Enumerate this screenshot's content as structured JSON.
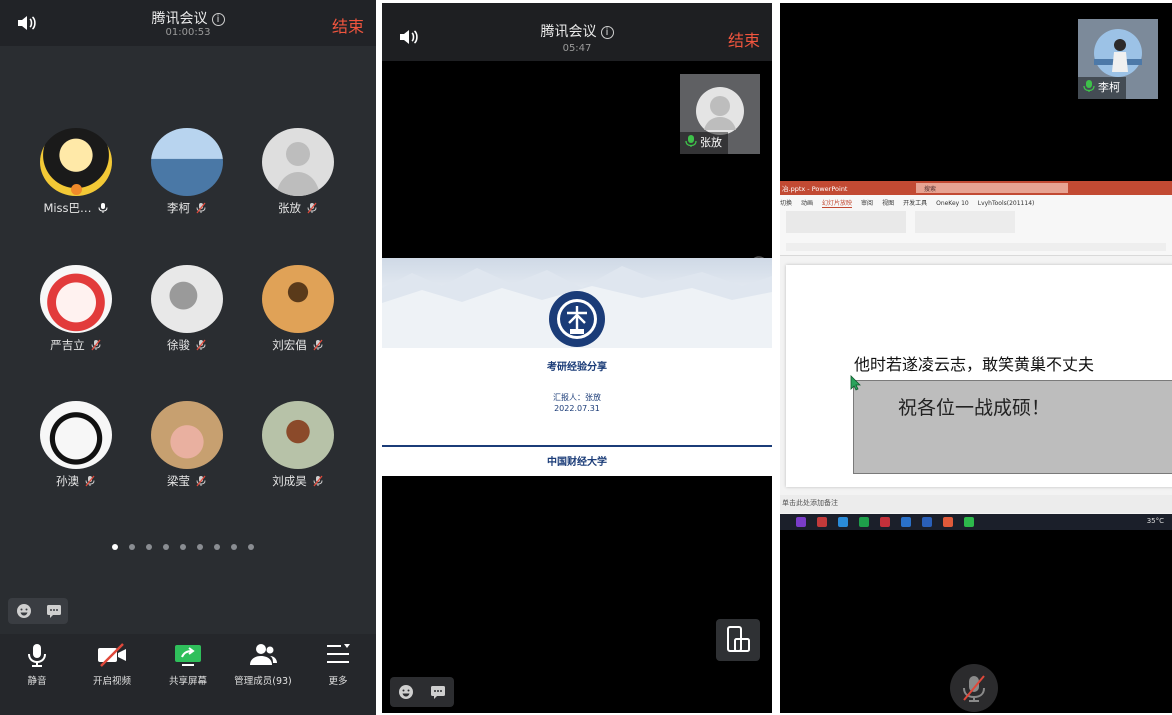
{
  "left_panel": {
    "title": "腾讯会议",
    "duration": "01:00:53",
    "end_label": "结束",
    "members": [
      {
        "name": "Miss巴…",
        "muted": false
      },
      {
        "name": "李柯",
        "muted": true
      },
      {
        "name": "张放",
        "muted": true
      },
      {
        "name": "严吉立",
        "muted": true
      },
      {
        "name": "徐骏",
        "muted": true
      },
      {
        "name": "刘宏倡",
        "muted": true
      },
      {
        "name": "孙澳",
        "muted": true
      },
      {
        "name": "梁莹",
        "muted": true
      },
      {
        "name": "刘成昊",
        "muted": true
      }
    ],
    "page_count": 9,
    "active_page": 1,
    "toolbar": [
      {
        "label": "静音",
        "icon": "mic-icon"
      },
      {
        "label": "开启视频",
        "icon": "video-off-icon"
      },
      {
        "label": "共享屏幕",
        "icon": "share-screen-icon"
      },
      {
        "label": "管理成员(93)",
        "icon": "members-icon"
      },
      {
        "label": "更多",
        "icon": "more-icon"
      }
    ]
  },
  "middle_panel": {
    "title": "腾讯会议",
    "duration": "05:47",
    "end_label": "结束",
    "speaker_name": "张放",
    "slide": {
      "title": "考研经验分享",
      "reporter": "汇报人：张放",
      "date": "2022.07.31",
      "footer_logo_text": "中国财经大学"
    }
  },
  "right_panel": {
    "speaker_name": "李柯",
    "ppt": {
      "window_title": "冶.pptx - PowerPoint",
      "search_placeholder": "搜索",
      "tabs": [
        "切换",
        "动画",
        "幻灯片放映",
        "审阅",
        "视图",
        "开发工具",
        "OneKey 10",
        "LvyhTools(201114)"
      ],
      "line1": "他时若遂凌云志，敢笑黄巢不丈夫",
      "line2": "祝各位一战成硕！",
      "notes_hint": "单击此处添加备注",
      "temp": "35°C"
    }
  },
  "colors": {
    "accent_red": "#f0553e",
    "bg_dark": "#2a2d31",
    "mic_green": "#3ec24a"
  }
}
